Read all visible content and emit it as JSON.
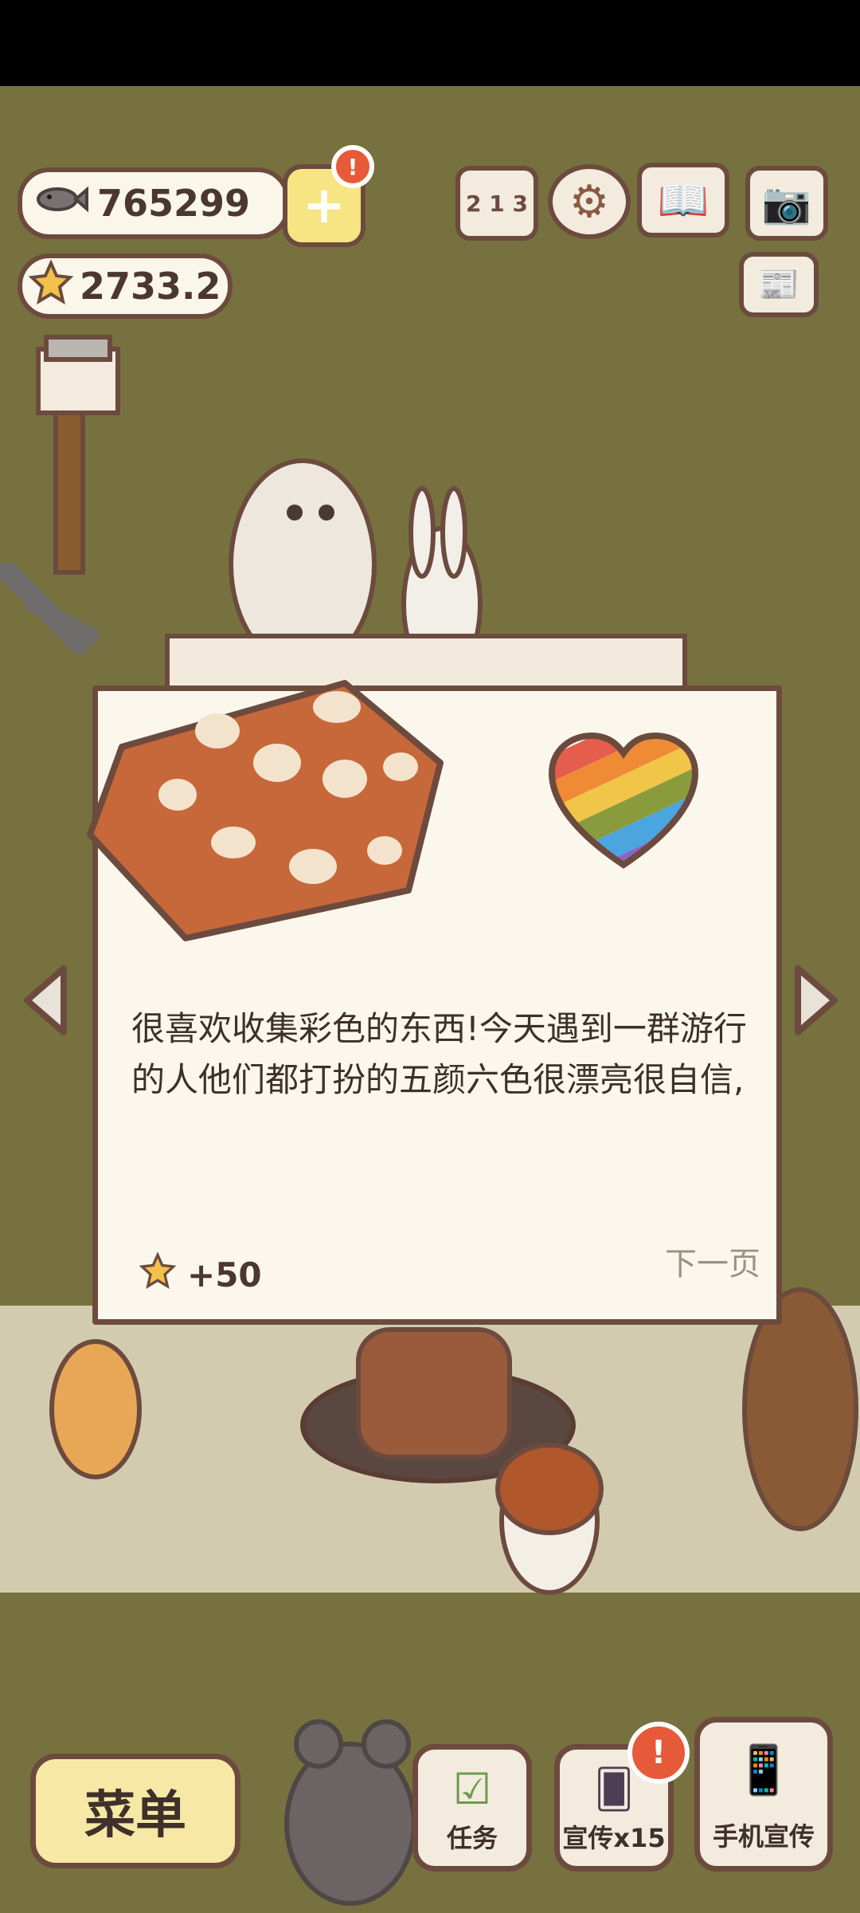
{
  "currencies": {
    "fish_amount": "765299",
    "star_amount": "2733.2"
  },
  "top_icons": {
    "plus_badge": "!"
  },
  "dialog": {
    "story_text": "很喜欢收集彩色的东西!今天遇到一群游行的人他们都打扮的五颜六色很漂亮很自信,",
    "next_page": "下一页",
    "reward": "+50"
  },
  "bottom_bar": {
    "menu_label": "菜单",
    "tasks_label": "任务",
    "promo_label": "宣传x15",
    "promo_badge": "!",
    "phone_promo_label": "手机宣传"
  },
  "colors": {
    "outline": "#6c4b3e",
    "card": "#fcf7ec",
    "accent_orange": "#e65a3a",
    "background": "#77713f"
  }
}
